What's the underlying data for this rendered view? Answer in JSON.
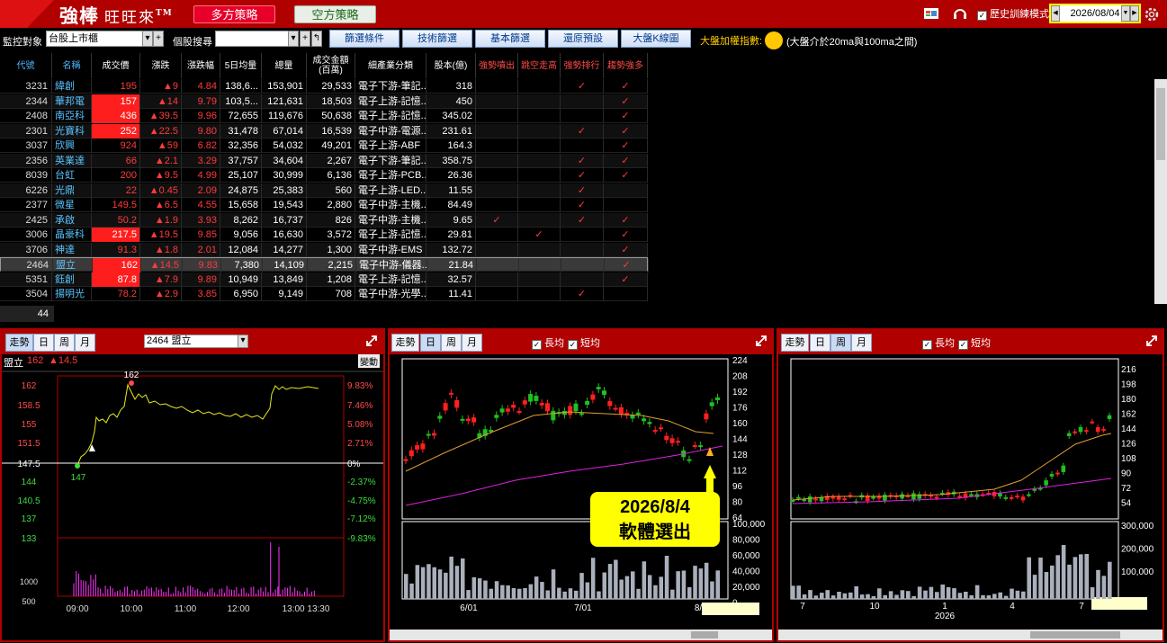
{
  "app": {
    "brand": "強棒",
    "brand_sub": "旺旺來",
    "tm": "TM",
    "strategy_long": "多方策略",
    "strategy_short": "空方策略"
  },
  "top": {
    "history_label": "歷史訓練模式",
    "history_checked": true,
    "date": "2026/08/04"
  },
  "toolbar": {
    "monitor_label": "監控對象",
    "monitor_value": "台股上市櫃",
    "search_label": "個股搜尋",
    "search_value": "",
    "buttons": [
      "篩選條件",
      "技術篩選",
      "基本篩選",
      "還原預設",
      "大盤K線圖"
    ],
    "index_label": "大盤加權指數:",
    "index_desc": "(大盤介於20ma與100ma之間)",
    "index_color": "#ffc800"
  },
  "table": {
    "headers": [
      "代號",
      "名稱",
      "成交價",
      "漲跌",
      "漲跌幅",
      "5日均量",
      "總量",
      "成交金額(百萬)",
      "細產業分類",
      "股本(億)",
      "強勢噴出",
      "跳空走高",
      "強勢排行",
      "趨勢強多"
    ],
    "rows": [
      {
        "code": "3231",
        "name": "緯創",
        "price": "195",
        "chg": "▲9",
        "pct": "4.84",
        "v5": "138,6...",
        "vol": "153,901",
        "amt": "29,533",
        "ind": "電子下游-筆記...",
        "cap": "318",
        "c1": "",
        "c2": "",
        "c3": "✓",
        "c4": "✓",
        "hi": false
      },
      {
        "code": "2344",
        "name": "華邦電",
        "price": "157",
        "chg": "▲14",
        "pct": "9.79",
        "v5": "103,5...",
        "vol": "121,631",
        "amt": "18,503",
        "ind": "電子上游-記憶...",
        "cap": "450",
        "c1": "",
        "c2": "",
        "c3": "",
        "c4": "✓",
        "hi": true
      },
      {
        "code": "2408",
        "name": "南亞科",
        "price": "436",
        "chg": "▲39.5",
        "pct": "9.96",
        "v5": "72,655",
        "vol": "119,676",
        "amt": "50,638",
        "ind": "電子上游-記憶...",
        "cap": "345.02",
        "c1": "",
        "c2": "",
        "c3": "",
        "c4": "✓",
        "hi": true
      },
      {
        "code": "2301",
        "name": "光寶科",
        "price": "252",
        "chg": "▲22.5",
        "pct": "9.80",
        "v5": "31,478",
        "vol": "67,014",
        "amt": "16,539",
        "ind": "電子中游-電源...",
        "cap": "231.61",
        "c1": "",
        "c2": "",
        "c3": "✓",
        "c4": "✓",
        "hi": true
      },
      {
        "code": "3037",
        "name": "欣興",
        "price": "924",
        "chg": "▲59",
        "pct": "6.82",
        "v5": "32,356",
        "vol": "54,032",
        "amt": "49,201",
        "ind": "電子上游-ABF",
        "cap": "164.3",
        "c1": "",
        "c2": "",
        "c3": "",
        "c4": "✓",
        "hi": false
      },
      {
        "code": "2356",
        "name": "英業達",
        "price": "66",
        "chg": "▲2.1",
        "pct": "3.29",
        "v5": "37,757",
        "vol": "34,604",
        "amt": "2,267",
        "ind": "電子下游-筆記...",
        "cap": "358.75",
        "c1": "",
        "c2": "",
        "c3": "✓",
        "c4": "✓",
        "hi": false
      },
      {
        "code": "8039",
        "name": "台虹",
        "price": "200",
        "chg": "▲9.5",
        "pct": "4.99",
        "v5": "25,107",
        "vol": "30,999",
        "amt": "6,136",
        "ind": "電子上游-PCB...",
        "cap": "26.36",
        "c1": "",
        "c2": "",
        "c3": "✓",
        "c4": "✓",
        "hi": false
      },
      {
        "code": "6226",
        "name": "光鼎",
        "price": "22",
        "chg": "▲0.45",
        "pct": "2.09",
        "v5": "24,875",
        "vol": "25,383",
        "amt": "560",
        "ind": "電子上游-LED...",
        "cap": "11.55",
        "c1": "",
        "c2": "",
        "c3": "✓",
        "c4": "",
        "hi": false
      },
      {
        "code": "2377",
        "name": "微星",
        "price": "149.5",
        "chg": "▲6.5",
        "pct": "4.55",
        "v5": "15,658",
        "vol": "19,543",
        "amt": "2,880",
        "ind": "電子中游-主機...",
        "cap": "84.49",
        "c1": "",
        "c2": "",
        "c3": "✓",
        "c4": "",
        "hi": false
      },
      {
        "code": "2425",
        "name": "承啟",
        "price": "50.2",
        "chg": "▲1.9",
        "pct": "3.93",
        "v5": "8,262",
        "vol": "16,737",
        "amt": "826",
        "ind": "電子中游-主機...",
        "cap": "9.65",
        "c1": "✓",
        "c2": "",
        "c3": "✓",
        "c4": "✓",
        "hi": false
      },
      {
        "code": "3006",
        "name": "晶豪科",
        "price": "217.5",
        "chg": "▲19.5",
        "pct": "9.85",
        "v5": "9,056",
        "vol": "16,630",
        "amt": "3,572",
        "ind": "電子上游-記憶...",
        "cap": "29.81",
        "c1": "",
        "c2": "✓",
        "c3": "",
        "c4": "✓",
        "hi": true
      },
      {
        "code": "3706",
        "name": "神達",
        "price": "91.3",
        "chg": "▲1.8",
        "pct": "2.01",
        "v5": "12,084",
        "vol": "14,277",
        "amt": "1,300",
        "ind": "電子中游-EMS",
        "cap": "132.72",
        "c1": "",
        "c2": "",
        "c3": "",
        "c4": "✓",
        "hi": false
      },
      {
        "code": "2464",
        "name": "盟立",
        "price": "162",
        "chg": "▲14.5",
        "pct": "9.83",
        "v5": "7,380",
        "vol": "14,109",
        "amt": "2,215",
        "ind": "電子中游-儀器...",
        "cap": "21.84",
        "c1": "",
        "c2": "",
        "c3": "",
        "c4": "✓",
        "hi": true
      },
      {
        "code": "5351",
        "name": "鈺創",
        "price": "87.8",
        "chg": "▲7.9",
        "pct": "9.89",
        "v5": "10,949",
        "vol": "13,849",
        "amt": "1,208",
        "ind": "電子上游-記憶...",
        "cap": "32.57",
        "c1": "",
        "c2": "",
        "c3": "",
        "c4": "✓",
        "hi": true
      },
      {
        "code": "3504",
        "name": "揚明光",
        "price": "78.2",
        "chg": "▲2.9",
        "pct": "3.85",
        "v5": "6,950",
        "vol": "9,149",
        "amt": "708",
        "ind": "電子中游-光學...",
        "cap": "11.41",
        "c1": "",
        "c2": "",
        "c3": "✓",
        "c4": "",
        "hi": false
      }
    ],
    "count": "44"
  },
  "panel1": {
    "tabs": [
      "走勢",
      "日",
      "周",
      "月"
    ],
    "stock": "2464 盟立",
    "quote_name": "盟立",
    "quote_price": "162",
    "quote_chg": "▲14.5",
    "change_btn": "變動",
    "hi_label": "162",
    "lo_label": "147",
    "y_left": [
      "162",
      "158.5",
      "155",
      "151.5",
      "147.5",
      "144",
      "140.5",
      "137",
      "133"
    ],
    "y_right": [
      "9.83%",
      "7.46%",
      "5.08%",
      "2.71%",
      "0%",
      "-2.37%",
      "-4.75%",
      "-7.12%",
      "-9.83%"
    ],
    "vol_ticks": [
      "1000",
      "500"
    ],
    "x_ticks": [
      "09:00",
      "10:00",
      "11:00",
      "12:00",
      "13:00 13:30"
    ]
  },
  "panel2": {
    "tabs": [
      "走勢",
      "日",
      "周",
      "月"
    ],
    "chk_long": "長均",
    "chk_short": "短均",
    "y_price": [
      "224",
      "208",
      "192",
      "176",
      "160",
      "144",
      "128",
      "112",
      "96",
      "80",
      "64"
    ],
    "y_vol": [
      "100,000",
      "80,000",
      "60,000",
      "40,000",
      "20,000",
      "0"
    ],
    "x_ticks": [
      "6/01",
      "7/01",
      "8/"
    ],
    "callout_line1": "2026/8/4",
    "callout_line2": "軟體選出"
  },
  "panel3": {
    "tabs": [
      "走勢",
      "日",
      "周",
      "月"
    ],
    "chk_long": "長均",
    "chk_short": "短均",
    "y_price": [
      "216",
      "198",
      "180",
      "162",
      "144",
      "126",
      "108",
      "90",
      "72",
      "54"
    ],
    "y_vol": [
      "300,000",
      "200,000",
      "100,000"
    ],
    "x_ticks": [
      "7",
      "10",
      "1",
      "4",
      "7"
    ],
    "x_year": "2026"
  }
}
